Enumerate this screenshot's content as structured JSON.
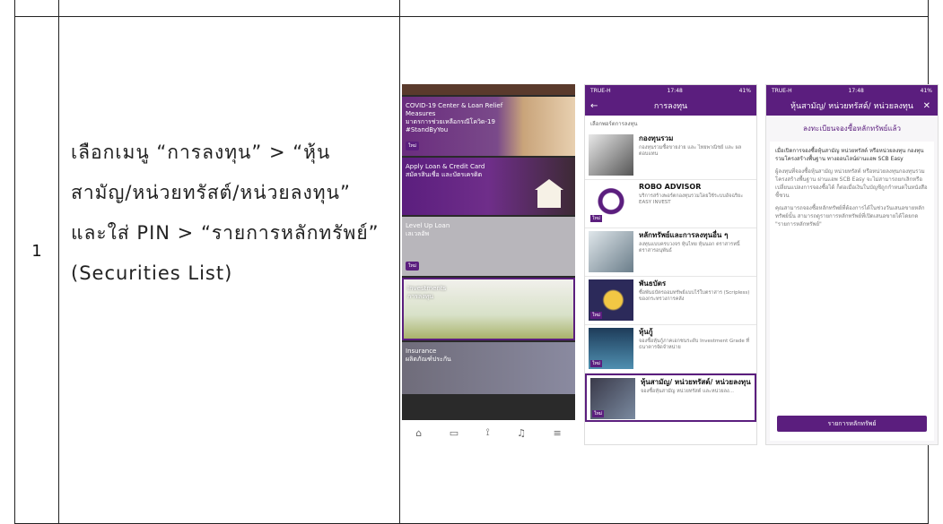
{
  "row": {
    "number": "1",
    "instruction_lines": [
      "เลือกเมนู “การลงทุน” > “หุ้น",
      "สามัญ/หน่วยทรัสต์/หน่วยลงทุน”",
      "และใส่ PIN > “รายการหลักทรัพย์”",
      "(Securities List)"
    ]
  },
  "phone1": {
    "cards": [
      {
        "title": "COVID-19 Center & Loan Relief Measures",
        "subtitle": "มาตรการช่วยเหลือกรณีโควิด-19",
        "tag": "#StandByYou",
        "badge": "ใหม่"
      },
      {
        "title": "Apply Loan & Credit Card",
        "subtitle": "สมัครสินเชื่อ และบัตรเครดิต"
      },
      {
        "title": "Level Up Loan",
        "subtitle": "เลเวลอัพ",
        "badge": "ใหม่"
      },
      {
        "title": "Investments",
        "subtitle": "การลงทุน"
      },
      {
        "title": "Insurance",
        "subtitle": "ผลิตภัณฑ์ประกัน"
      }
    ],
    "tabbar": [
      "⌂",
      "▭",
      "⟟",
      "♫",
      "≡"
    ]
  },
  "phone2": {
    "status_left": "TRUE-H",
    "status_time": "17:48",
    "status_right": "41%",
    "title": "การลงทุน",
    "section_label": "เลือกพอร์ตการลงทุน",
    "items": [
      {
        "title": "กองทุนรวม",
        "subtitle": "กองทุนรวมซื้อขายง่าย และ ไทยพาณิชย์ และ ผลตอบแทน",
        "badge": ""
      },
      {
        "title": "ROBO ADVISOR",
        "subtitle": "บริการสร้างพอร์ตกองทุนรวมโดยใช้ระบบอัจฉริยะ EASY INVEST",
        "badge": "ใหม่"
      },
      {
        "title": "หลักทรัพย์และการลงทุนอื่น ๆ",
        "subtitle": "ลงทุนแบบครบวงจร หุ้นไทย หุ้นนอก ตราสารหนี้ ตราสารอนุพันธ์",
        "badge": ""
      },
      {
        "title": "พันธบัตร",
        "subtitle": "ซื้อพันธบัตรออมทรัพย์แบบไร้ใบตราสาร (Scripless) ของกระทรวงการคลัง",
        "badge": "ใหม่"
      },
      {
        "title": "หุ้นกู้",
        "subtitle": "จองซื้อหุ้นกู้ภาคเอกชนระดับ Investment Grade ที่ธนาคารจัดจำหน่าย",
        "badge": "ใหม่"
      },
      {
        "title": "หุ้นสามัญ/ หน่วยทรัสต์/ หน่วยลงทุน",
        "subtitle": "จองซื้อหุ้นสามัญ หน่วยทรัสต์ และหน่วยลง...",
        "badge": "ใหม่"
      }
    ]
  },
  "phone3": {
    "status_left": "TRUE-H",
    "status_time": "17:48",
    "status_right": "41%",
    "title": "หุ้นสามัญ/ หน่วยทรัสต์/ หน่วยลงทุน",
    "subheader": "ลงทะเบียนจองซื้อหลักทรัพย์แล้ว",
    "paragraphs": [
      "เมื่อเปิดการจองซื้อหุ้นสามัญ หน่วยทรัสต์ หรือหน่วยลงทุน กองทุนรวมโครงสร้างพื้นฐาน ทางออนไลน์ผ่านแอพ SCB Easy",
      "ผู้ลงทุนที่จองซื้อหุ้นสามัญ หน่วยทรัสต์ หรือหน่วยลงทุนกองทุนรวมโครงสร้างพื้นฐาน ผ่านแอพ SCB Easy จะไม่สามารถยกเลิกหรือเปลี่ยนแปลงการจองซื้อได้ ก็ต่อเมื่อเงินในบัญชีถูกกำหนดในหนังสือชี้ชวน",
      "คุณสามารถจองซื้อหลักทรัพย์ที่ต้องการได้ในช่วงวันเสนอขายหลักทรัพย์นั้น สามารถดูรายการหลักทรัพย์ที่เปิดเสนอขายได้โดยกด \"รายการหลักทรัพย์\""
    ],
    "button": "รายการหลักทรัพย์"
  }
}
